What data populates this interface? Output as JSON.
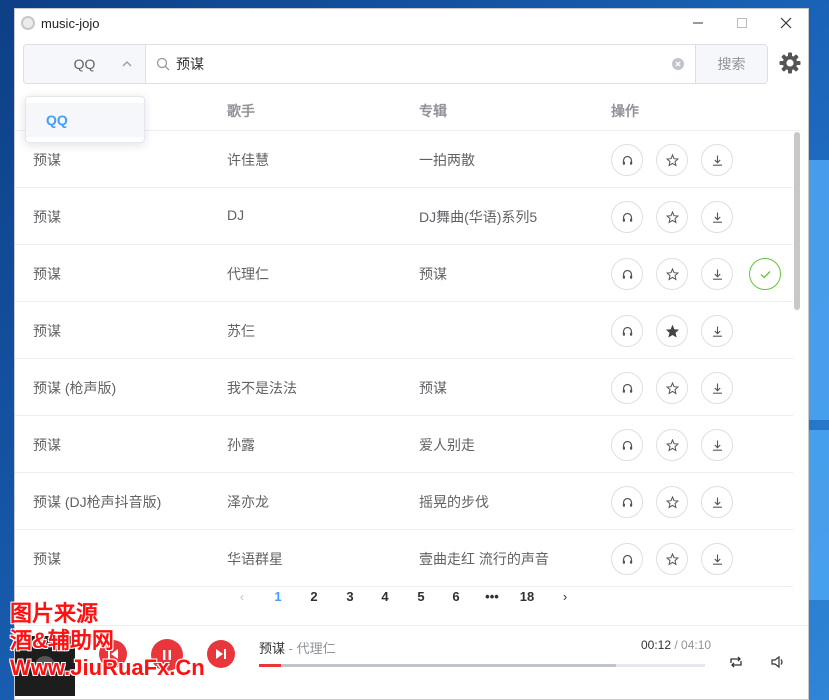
{
  "app": {
    "title": "music-jojo"
  },
  "window_controls": {
    "minimize": "—",
    "maximize": "☐",
    "close": "✕"
  },
  "search": {
    "source_selected": "QQ",
    "query": "预谋",
    "button_label": "搜索"
  },
  "dropdown": {
    "options": [
      "QQ"
    ]
  },
  "table": {
    "columns": {
      "artist": "歌手",
      "album": "专辑",
      "actions": "操作"
    },
    "rows": [
      {
        "song": "预谋",
        "artist": "许佳慧",
        "album": "一拍两散",
        "favorited": false,
        "downloaded": false
      },
      {
        "song": "预谋",
        "artist": "DJ",
        "album": "DJ舞曲(华语)系列5",
        "favorited": false,
        "downloaded": false
      },
      {
        "song": "预谋",
        "artist": "代理仁",
        "album": "预谋",
        "favorited": false,
        "downloaded": true
      },
      {
        "song": "预谋",
        "artist": "苏仨",
        "album": "",
        "favorited": true,
        "downloaded": false
      },
      {
        "song": "预谋 (枪声版)",
        "artist": "我不是法法",
        "album": "预谋",
        "favorited": false,
        "downloaded": false
      },
      {
        "song": "预谋",
        "artist": "孙露",
        "album": "爱人别走",
        "favorited": false,
        "downloaded": false
      },
      {
        "song": "预谋 (DJ枪声抖音版)",
        "artist": "泽亦龙",
        "album": "摇晃的步伐",
        "favorited": false,
        "downloaded": false
      },
      {
        "song": "预谋",
        "artist": "华语群星",
        "album": "壹曲走红 流行的声音",
        "favorited": false,
        "downloaded": false
      }
    ]
  },
  "pagination": {
    "prev": "‹",
    "pages": [
      "1",
      "2",
      "3",
      "4",
      "5",
      "6",
      "•••",
      "18"
    ],
    "current": "1",
    "next": "›"
  },
  "player": {
    "song": "预谋",
    "separator": " - ",
    "artist": "代理仁",
    "current_time": "00:12",
    "time_separator": " / ",
    "total_time": "04:10",
    "progress": 0.05,
    "buffered": 0.8
  },
  "watermark": {
    "line1": "图片来源",
    "line2": "酒&辅助网",
    "line3": "Www.JiuRuaFx.Cn"
  },
  "colors": {
    "accent_blue": "#409eff",
    "player_red": "#e8363c",
    "done_green": "#67c23a"
  }
}
